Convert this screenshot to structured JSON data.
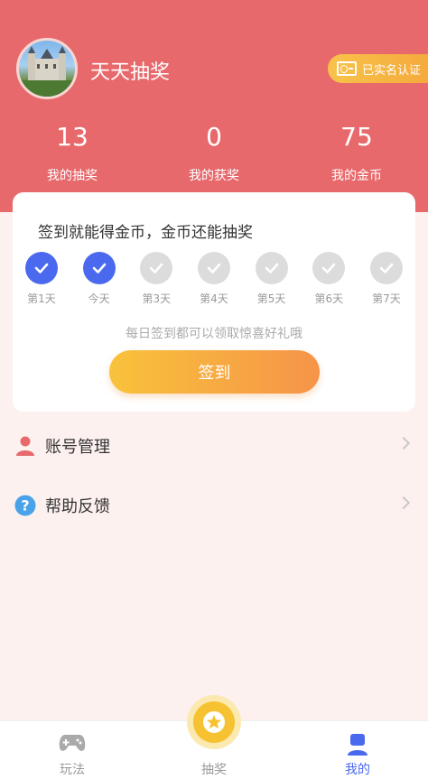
{
  "profile": {
    "username": "天天抽奖",
    "verified_label": "已实名认证"
  },
  "stats": [
    {
      "value": "13",
      "label": "我的抽奖"
    },
    {
      "value": "0",
      "label": "我的获奖"
    },
    {
      "value": "75",
      "label": "我的金币"
    }
  ],
  "signin": {
    "title": "签到就能得金币，金币还能抽奖",
    "days": [
      {
        "label": "第1天",
        "checked": true
      },
      {
        "label": "今天",
        "checked": true
      },
      {
        "label": "第3天",
        "checked": false
      },
      {
        "label": "第4天",
        "checked": false
      },
      {
        "label": "第5天",
        "checked": false
      },
      {
        "label": "第6天",
        "checked": false
      },
      {
        "label": "第7天",
        "checked": false
      }
    ],
    "hint": "每日签到都可以领取惊喜好礼哦",
    "button_label": "签到"
  },
  "menu": [
    {
      "label": "账号管理",
      "icon": "user-icon"
    },
    {
      "label": "帮助反馈",
      "icon": "help-icon"
    }
  ],
  "tabs": [
    {
      "label": "玩法",
      "icon": "gamepad-icon",
      "active": false
    },
    {
      "label": "抽奖",
      "icon": "star-icon",
      "active": false
    },
    {
      "label": "我的",
      "icon": "person-icon",
      "active": true
    }
  ],
  "colors": {
    "header": "#e8696c",
    "accent": "#4a69ee",
    "button_gradient_start": "#f8c23b",
    "button_gradient_end": "#f69449"
  }
}
